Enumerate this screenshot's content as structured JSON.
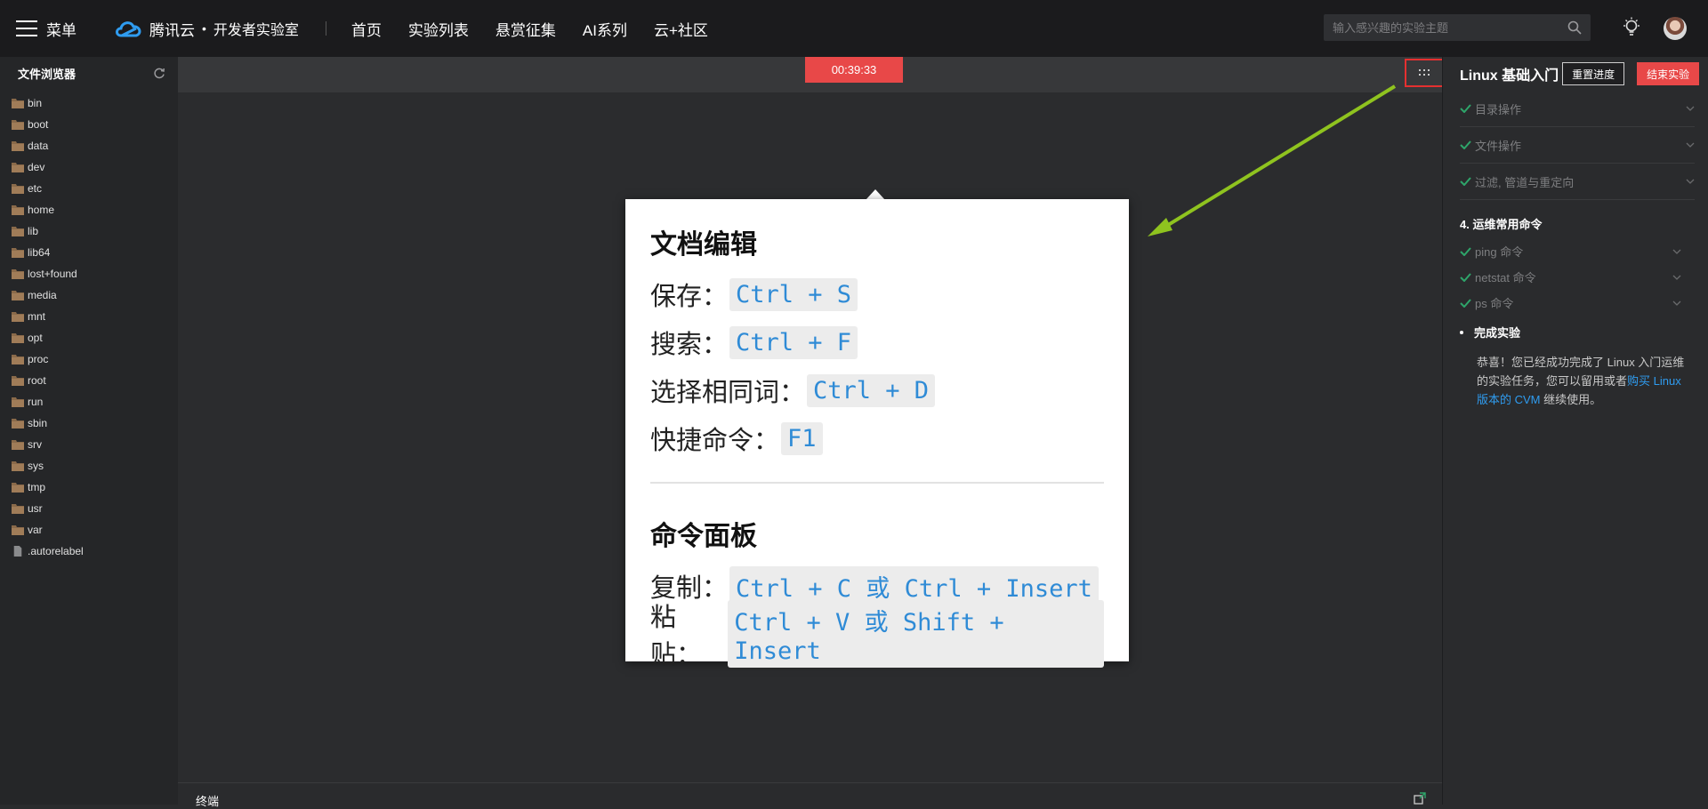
{
  "topbar": {
    "menu_label": "菜单",
    "logo_text": "腾讯云",
    "logo_dot": "•",
    "logo_sub": "开发者实验室",
    "nav": [
      "首页",
      "实验列表",
      "悬赏征集",
      "AI系列",
      "云+社区"
    ],
    "search_placeholder": "输入感兴趣的实验主题"
  },
  "sidebar": {
    "title": "文件浏览器",
    "files": [
      {
        "name": "bin",
        "type": "folder"
      },
      {
        "name": "boot",
        "type": "folder"
      },
      {
        "name": "data",
        "type": "folder"
      },
      {
        "name": "dev",
        "type": "folder"
      },
      {
        "name": "etc",
        "type": "folder"
      },
      {
        "name": "home",
        "type": "folder"
      },
      {
        "name": "lib",
        "type": "folder"
      },
      {
        "name": "lib64",
        "type": "folder"
      },
      {
        "name": "lost+found",
        "type": "folder"
      },
      {
        "name": "media",
        "type": "folder"
      },
      {
        "name": "mnt",
        "type": "folder"
      },
      {
        "name": "opt",
        "type": "folder"
      },
      {
        "name": "proc",
        "type": "folder"
      },
      {
        "name": "root",
        "type": "folder"
      },
      {
        "name": "run",
        "type": "folder"
      },
      {
        "name": "sbin",
        "type": "folder"
      },
      {
        "name": "srv",
        "type": "folder"
      },
      {
        "name": "sys",
        "type": "folder"
      },
      {
        "name": "tmp",
        "type": "folder"
      },
      {
        "name": "usr",
        "type": "folder"
      },
      {
        "name": "var",
        "type": "folder"
      },
      {
        "name": ".autorelabel",
        "type": "file"
      }
    ]
  },
  "main": {
    "timer": "00:39:33",
    "terminal_label": "终端"
  },
  "popup": {
    "section1_title": "文档编辑",
    "section1_items": [
      {
        "label": "保存：",
        "keys": "Ctrl + S"
      },
      {
        "label": "搜索：",
        "keys": "Ctrl + F"
      },
      {
        "label": "选择相同词：",
        "keys": "Ctrl + D"
      },
      {
        "label": "快捷命令：",
        "keys": "F1"
      }
    ],
    "section2_title": "命令面板",
    "section2_items": [
      {
        "label": "复制：",
        "keys": "Ctrl + C 或 Ctrl + Insert"
      },
      {
        "label": "粘贴：",
        "keys": "Ctrl + V 或 Shift + Insert"
      }
    ]
  },
  "right_panel": {
    "title": "Linux 基础入门",
    "reset_label": "重置进度",
    "end_label": "结束实验",
    "sections": [
      "目录操作",
      "文件操作",
      "过滤, 管道与重定向"
    ],
    "chapter": "4. 运维常用命令",
    "sub_items": [
      "ping 命令",
      "netstat 命令",
      "ps 命令"
    ],
    "done_label": "完成实验",
    "congrats_text": "恭喜！您已经成功完成了 Linux 入门运维的实验任务，您可以留用或者",
    "congrats_link": "购买 Linux 版本的 CVM",
    "congrats_tail": " 继续使用。"
  },
  "colors": {
    "accent_red": "#e84848",
    "check_green": "#2ea56a",
    "link_blue": "#2f9cf0",
    "arrow_green": "#8fc31f",
    "key_blue": "#2f8bd6"
  },
  "icons": {
    "menu": "hamburger-icon",
    "logo": "cloud-logo-icon",
    "search": "search-icon",
    "theme": "bulb-icon",
    "refresh": "refresh-icon",
    "folder": "folder-icon",
    "file": "file-icon",
    "shortcuts": "grid-dots-icon",
    "check": "check-icon",
    "chevron": "chevron-down-icon",
    "popout": "popout-icon"
  }
}
